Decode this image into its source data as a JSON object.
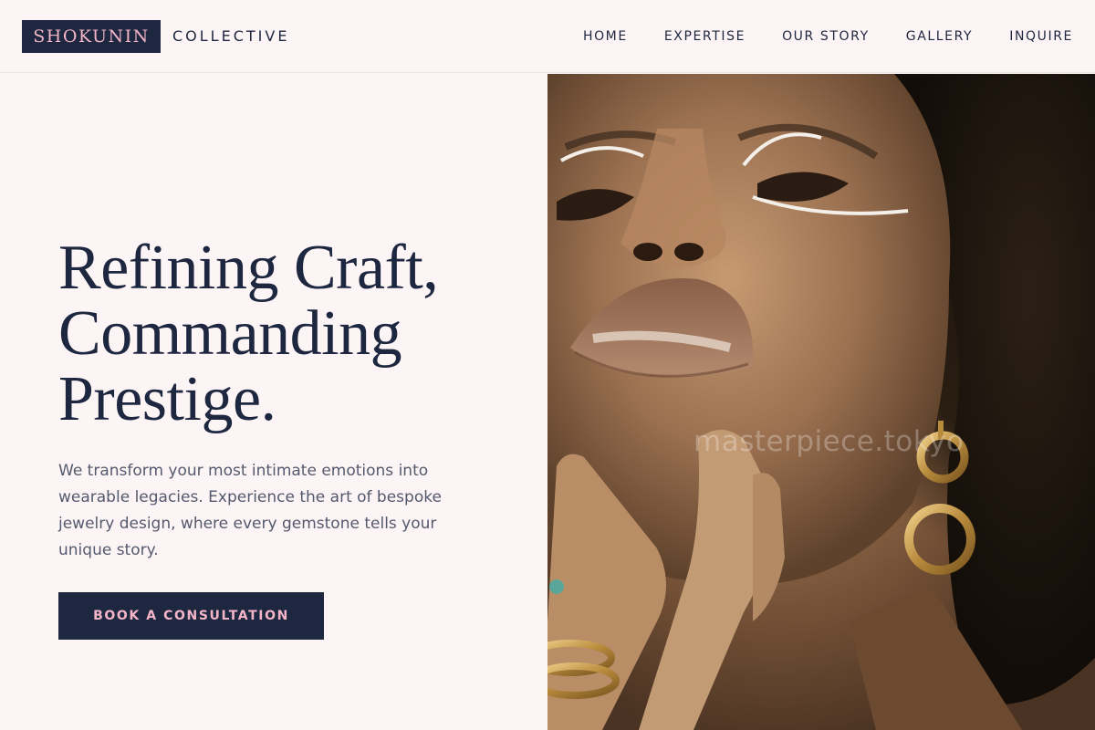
{
  "brand": {
    "mark": "SHOKUNIN",
    "name": "COLLECTIVE"
  },
  "nav": {
    "items": [
      {
        "label": "HOME"
      },
      {
        "label": "EXPERTISE"
      },
      {
        "label": "OUR STORY"
      },
      {
        "label": "GALLERY"
      },
      {
        "label": "INQUIRE"
      }
    ]
  },
  "hero": {
    "headline": [
      "Refining Craft,",
      "Commanding",
      "Prestige."
    ],
    "lead": "We transform your most intimate emotions into wearable legacies. Experience the art of bespoke jewelry design, where every gemstone tells your unique story.",
    "cta_label": "BOOK A CONSULTATION"
  },
  "image": {
    "watermark": "masterpiece.tokyo"
  },
  "colors": {
    "background": "#fdf4f5",
    "navy": "#1e2740",
    "accent_pink": "#f4b5c6",
    "body_text": "#545a6e"
  }
}
